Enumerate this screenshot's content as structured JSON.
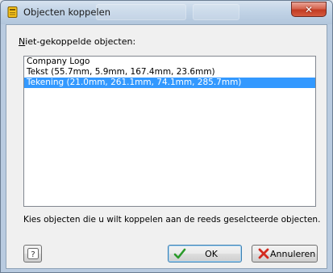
{
  "window": {
    "title": "Objecten koppelen",
    "close_glyph": "✕"
  },
  "list": {
    "label_accel": "N",
    "label_rest": "iet-gekoppelde objecten:",
    "items": [
      {
        "text": "Company Logo",
        "selected": false
      },
      {
        "text": "Tekst (55.7mm, 5.9mm, 167.4mm, 23.6mm)",
        "selected": false
      },
      {
        "text": "Tekening (21.0mm, 261.1mm, 74.1mm, 285.7mm)",
        "selected": true
      }
    ]
  },
  "hint": "Kies objecten die u wilt koppelen aan de reeds geselcteerde objecten.",
  "buttons": {
    "help_icon": "help-icon",
    "ok_label": "OK",
    "ok_icon": "checkmark-icon",
    "cancel_label": "Annuleren",
    "cancel_icon": "red-x-icon"
  },
  "colors": {
    "selection": "#3399ff",
    "ok_check": "#2a9a2a",
    "cancel_x": "#d32a1f",
    "close_button": "#c23b22"
  }
}
